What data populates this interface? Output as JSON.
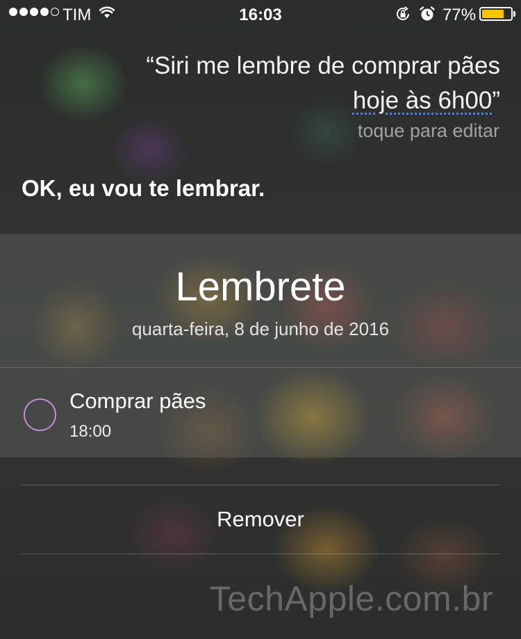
{
  "status_bar": {
    "carrier": "TIM",
    "signal_bars_filled": 4,
    "signal_bars_total": 5,
    "time": "16:03",
    "battery_percent": "77%",
    "battery_level": 0.77,
    "battery_color": "#f7c600",
    "icons": [
      "wifi-icon",
      "orientation-lock-icon",
      "alarm-icon",
      "battery-icon"
    ]
  },
  "siri": {
    "query_part1": "“Siri me lembre de comprar pães",
    "query_part2": "hoje às 6h00",
    "query_close": "”",
    "edit_hint": "toque para editar",
    "response": "OK, eu vou te lembrar."
  },
  "reminder_card": {
    "title": "Lembrete",
    "date": "quarta-feira, 8 de junho de 2016",
    "item": {
      "title": "Comprar pães",
      "time": "18:00",
      "checkbox_color": "#c58bd8"
    }
  },
  "actions": {
    "remove_label": "Remover"
  },
  "watermark": "TechApple.com.br"
}
